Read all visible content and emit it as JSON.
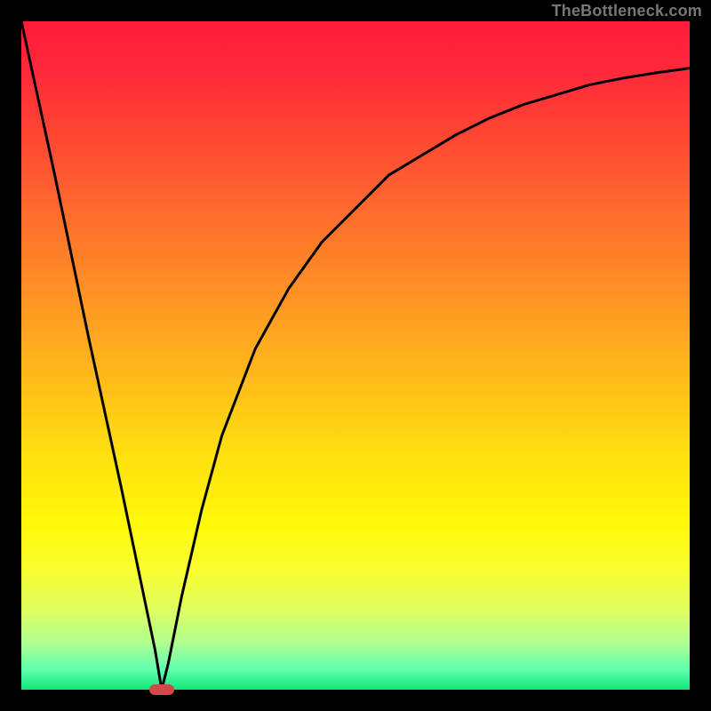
{
  "watermark": "TheBottleneck.com",
  "chart_data": {
    "type": "line",
    "title": "",
    "xlabel": "",
    "ylabel": "",
    "xlim": [
      0,
      100
    ],
    "ylim": [
      0,
      100
    ],
    "background_gradient": {
      "top_color": "#ff1a3a",
      "bottom_color": "#10e878",
      "description": "vertical gradient red-orange-yellow-green"
    },
    "series": [
      {
        "name": "bottleneck-curve",
        "description": "V-shaped curve: steep linear descent from top-left to a minimum near x≈21, then asymptotic rise toward top-right",
        "x": [
          0,
          5,
          10,
          15,
          20,
          21,
          22,
          24,
          27,
          30,
          35,
          40,
          45,
          50,
          55,
          60,
          65,
          70,
          75,
          80,
          85,
          90,
          95,
          100
        ],
        "values": [
          100,
          77,
          53,
          30,
          6,
          0,
          4,
          14,
          27,
          38,
          51,
          60,
          67,
          72,
          77,
          80,
          83,
          85.5,
          87.5,
          89,
          90.5,
          91.5,
          92.3,
          93
        ]
      }
    ],
    "marker": {
      "name": "optimal-point",
      "x": 21,
      "y": 0,
      "width_frac": 0.038,
      "color": "#d04848"
    }
  }
}
